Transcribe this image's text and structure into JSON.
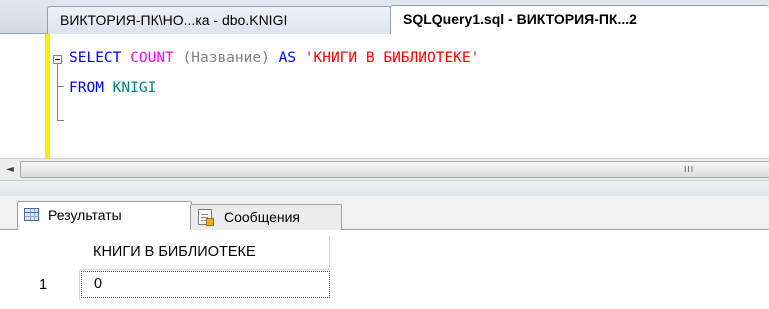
{
  "document_tabs": [
    {
      "label": "ВИКТОРИЯ-ПК\\НО...ка - dbo.KNIGI",
      "active": false
    },
    {
      "label": "SQLQuery1.sql - ВИКТОРИЯ-ПК...2",
      "active": true
    }
  ],
  "editor": {
    "line1": {
      "kw_select": "SELECT",
      "fn_count": "COUNT",
      "paren_open": "(",
      "column": "Название",
      "paren_close": ")",
      "kw_as": "AS",
      "alias": "'КНИГИ В БИБЛИОТЕКЕ'"
    },
    "line2": {
      "kw_from": "FROM",
      "table": "KNIGI"
    }
  },
  "scrollbar": {
    "left_arrow": "◄",
    "grip": "III"
  },
  "results_tabs": [
    {
      "label": "Результаты",
      "icon": "grid-icon",
      "active": true
    },
    {
      "label": "Сообщения",
      "icon": "messages-icon",
      "active": false
    }
  ],
  "results_grid": {
    "columns": [
      "КНИГИ В БИБЛИОТЕКЕ"
    ],
    "rows": [
      {
        "row_number": "1",
        "cells": [
          "0"
        ]
      }
    ]
  },
  "colors": {
    "keyword": "#0000ff",
    "function": "#ff00ff",
    "operator": "#808080",
    "identifier": "#008080",
    "string": "#ff0000",
    "change_marker": "#ffeb00"
  }
}
